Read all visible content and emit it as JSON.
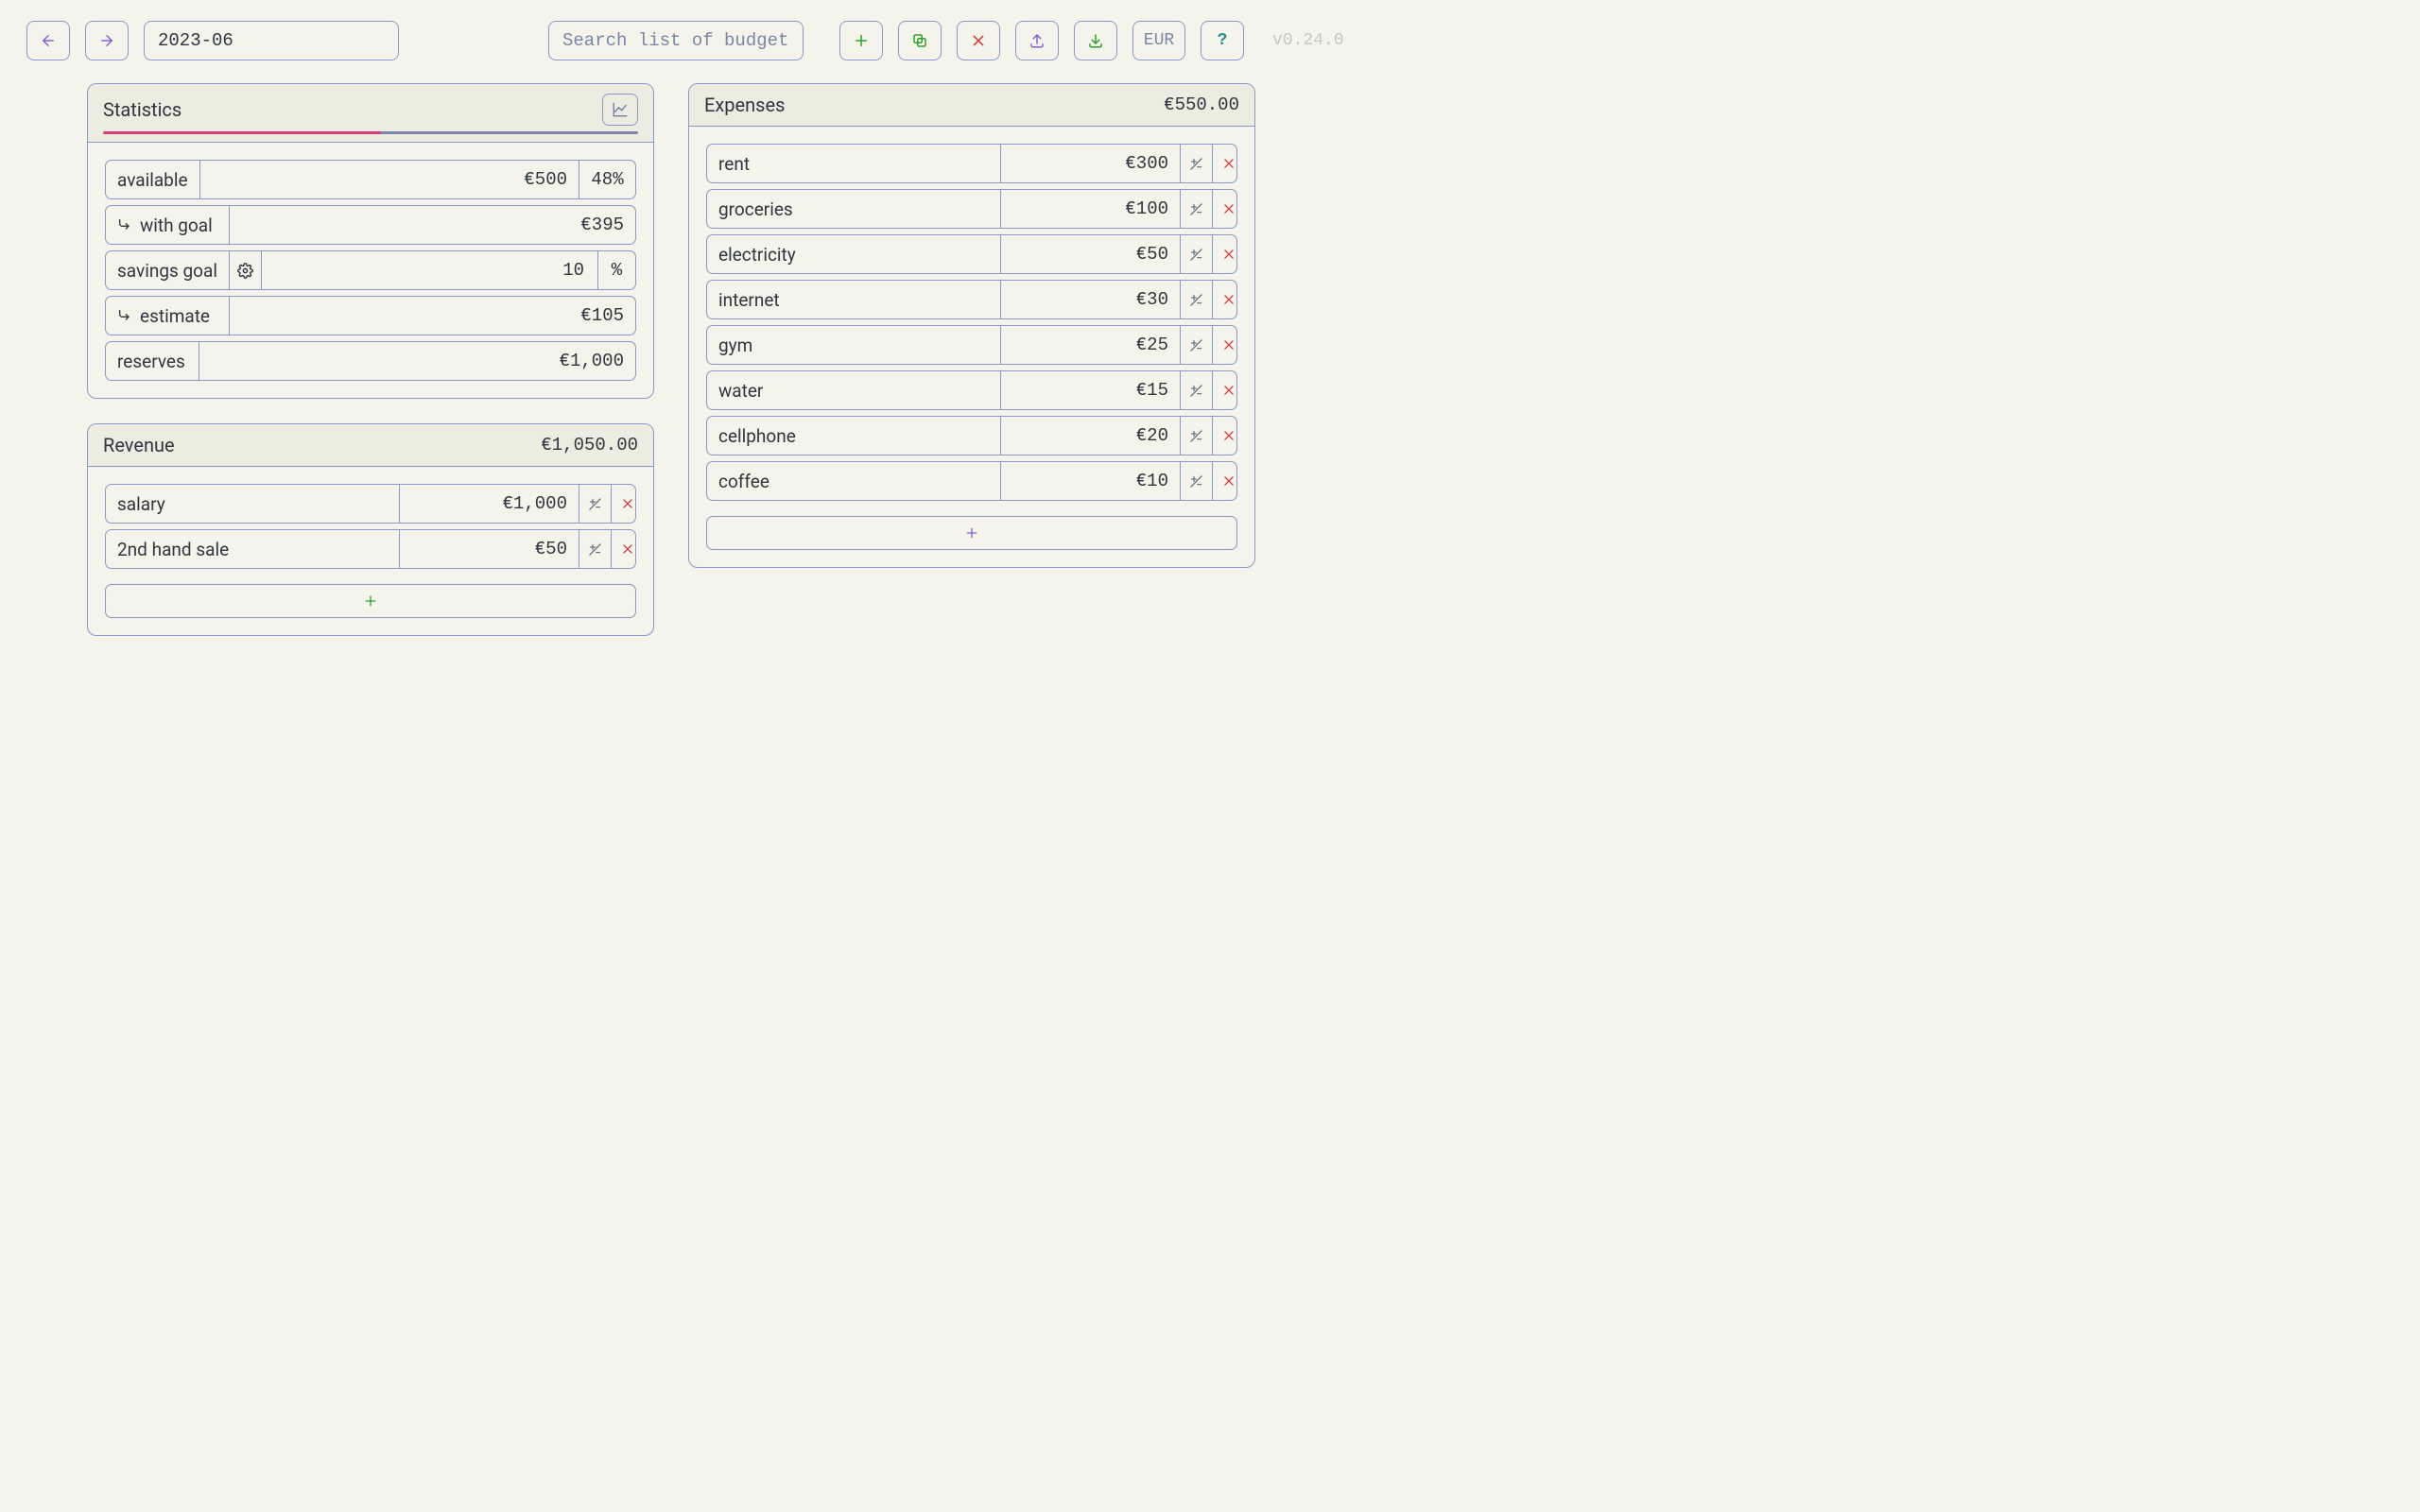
{
  "toolbar": {
    "period": "2023-06",
    "search_placeholder": "Search list of budgets...",
    "currency_label": "EUR",
    "help_label": "?",
    "version": "v0.24.0"
  },
  "statistics": {
    "title": "Statistics",
    "bar": {
      "pink_pct": 52,
      "slate_pct": 48
    },
    "available": {
      "label": "available",
      "value": "€500",
      "pct": "48%"
    },
    "with_goal": {
      "label": "with goal",
      "value": "€395"
    },
    "savings_goal": {
      "label": "savings goal",
      "value": "10",
      "unit": "%"
    },
    "estimate": {
      "label": "estimate",
      "value": "€105"
    },
    "reserves": {
      "label": "reserves",
      "value": "€1,000"
    }
  },
  "revenue": {
    "title": "Revenue",
    "total": "€1,050.00",
    "items": [
      {
        "name": "salary",
        "amount": "€1,000"
      },
      {
        "name": "2nd hand sale",
        "amount": "€50"
      }
    ]
  },
  "expenses": {
    "title": "Expenses",
    "total": "€550.00",
    "items": [
      {
        "name": "rent",
        "amount": "€300"
      },
      {
        "name": "groceries",
        "amount": "€100"
      },
      {
        "name": "electricity",
        "amount": "€50"
      },
      {
        "name": "internet",
        "amount": "€30"
      },
      {
        "name": "gym",
        "amount": "€25"
      },
      {
        "name": "water",
        "amount": "€15"
      },
      {
        "name": "cellphone",
        "amount": "€20"
      },
      {
        "name": "coffee",
        "amount": "€10"
      }
    ]
  },
  "colors": {
    "border": "#8a97cc",
    "pink": "#e13a7a",
    "slate": "#7a86b0",
    "green": "#2aa22a",
    "red": "#d43a3a",
    "purple": "#8660d8",
    "teal": "#2a8f8f"
  }
}
